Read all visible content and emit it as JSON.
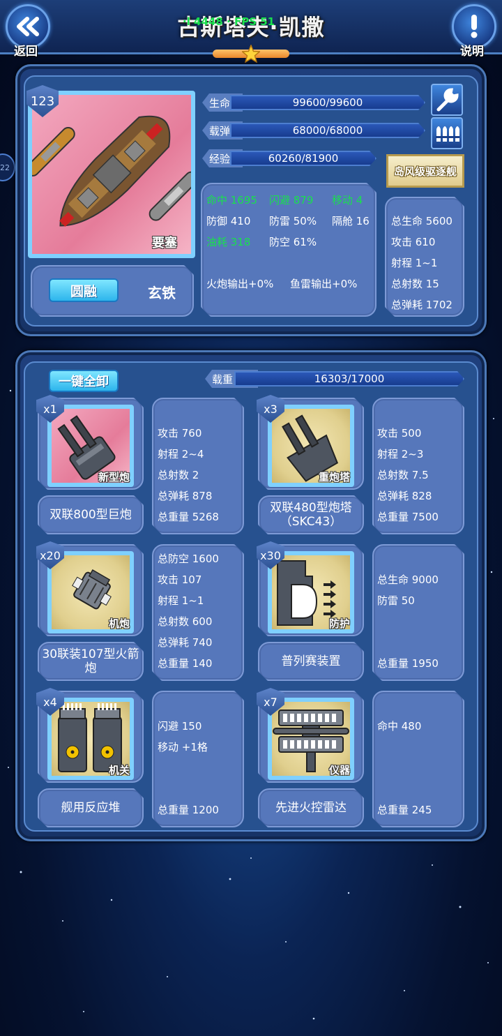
{
  "header": {
    "title": "古斯塔夫·凯撒",
    "fps": "·l 4448 · FPS 51",
    "back_label": "返回",
    "help_label": "说明",
    "star_count": 1
  },
  "ship": {
    "level": "123",
    "type_tag": "要塞",
    "mode_active": "圆融",
    "mode_other": "玄铁",
    "class_badge": "岛风级驱逐舰",
    "bars": [
      {
        "label": "生命",
        "value": "99600/99600"
      },
      {
        "label": "载弹",
        "value": "68000/68000"
      },
      {
        "label": "经验",
        "value": "60260/81900"
      }
    ],
    "stats": {
      "hit": "命中 1695",
      "evade": "闪避 879",
      "move": "移动 4",
      "defense": "防御 410",
      "torpedo_def": "防雷 50%",
      "bulkhead": "隔舱 16",
      "fuel": "油耗 318",
      "aa": "防空 61%",
      "gun_out": "火炮输出+0%",
      "torp_out": "鱼雷输出+0%"
    },
    "totals": [
      "总生命 5600",
      "攻击 610",
      "射程 1~1",
      "总射数 15",
      "总弹耗 1702"
    ]
  },
  "loadout": {
    "unload_all": "一键全卸",
    "weight_label": "载重",
    "weight_value": "16303/17000",
    "items": [
      {
        "count": "x1",
        "tag": "新型炮",
        "name": "双联800型巨炮",
        "stats": [
          "攻击 760",
          "射程 2~4",
          "总射数 2",
          "总弹耗 878",
          "总重量 5268"
        ]
      },
      {
        "count": "x3",
        "tag": "重炮塔",
        "name": "双联480型炮塔（SKC43）",
        "stats": [
          "攻击 500",
          "射程 2~3",
          "总射数 7.5",
          "总弹耗 828",
          "总重量 7500"
        ]
      },
      {
        "count": "x20",
        "tag": "机炮",
        "name": "30联装107型火箭炮",
        "stats": [
          "总防空 1600",
          "攻击 107",
          "射程 1~1",
          "总射数 600",
          "总弹耗 740",
          "总重量 140"
        ]
      },
      {
        "count": "x30",
        "tag": "防护",
        "name": "普列赛装置",
        "stats": [
          "总生命 9000",
          "防雷 50",
          "",
          "",
          "",
          "总重量 1950"
        ]
      },
      {
        "count": "x4",
        "tag": "机关",
        "name": "舰用反应堆",
        "stats": [
          "闪避 150",
          "移动 +1格",
          "",
          "",
          "",
          "总重量 1200"
        ]
      },
      {
        "count": "x7",
        "tag": "仪器",
        "name": "先进火控雷达",
        "stats": [
          "命中 480",
          "",
          "",
          "",
          "",
          "总重量 245"
        ]
      }
    ]
  },
  "side_badge": "22",
  "colors": {
    "accent_cyan": "#2db5ec",
    "stat_green": "#19e04d",
    "card_blue": "#5677bb"
  }
}
